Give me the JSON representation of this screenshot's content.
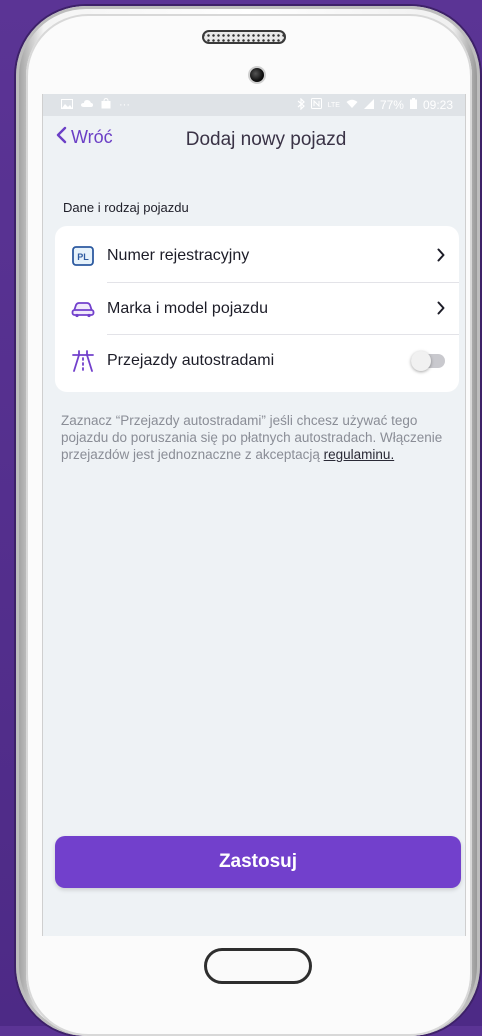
{
  "status_bar": {
    "battery": "77%",
    "time": "09:23",
    "network": "LTE"
  },
  "header": {
    "back_label": "Wróć",
    "title": "Dodaj nowy pojazd"
  },
  "section": {
    "label": "Dane i rodzaj pojazdu"
  },
  "rows": [
    {
      "label": "Numer rejestracyjny",
      "icon": "license-plate-icon",
      "badge": "PL",
      "has_arrow": true
    },
    {
      "label": "Marka i model pojazdu",
      "icon": "car-icon",
      "has_arrow": true
    },
    {
      "label": "Przejazdy autostradami",
      "icon": "highway-icon",
      "toggle_on": false
    }
  ],
  "info": {
    "text": "Zaznacz “Przejazdy autostradami” jeśli chcesz używać tego pojazdu do poruszania się po płatnych autostradach. Włączenie przejazdów jest jednoznaczne z akceptacją ",
    "link": "regulaminu."
  },
  "apply_button": {
    "label": "Zastosuj"
  },
  "colors": {
    "accent": "#7240cc",
    "background": "#4d2a86",
    "screen": "#eef2f5"
  }
}
